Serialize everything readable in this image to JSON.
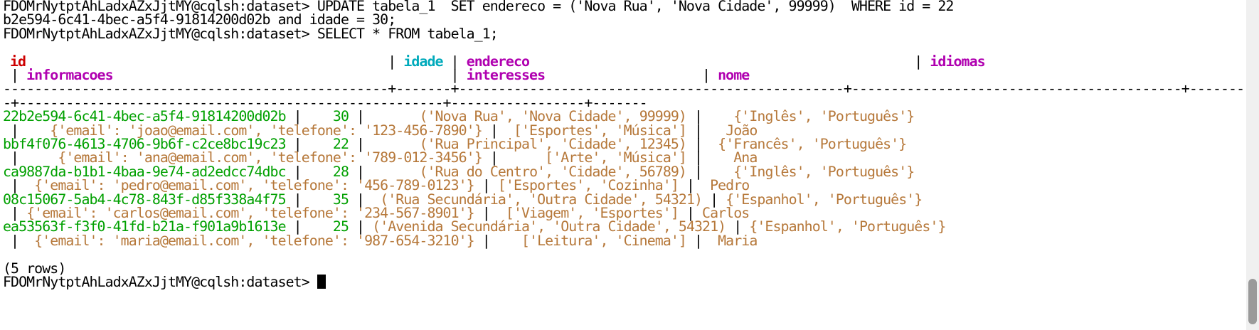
{
  "terminal": {
    "prompt": "FDOMrNytptAhLadxAZxJjtMY@cqlsh:dataset> ",
    "update_cmd_1": "UPDATE tabela_1  SET endereco = ('Nova Rua', 'Nova Cidade', 99999)  WHERE id = 22",
    "update_cmd_2": "b2e594-6c41-4bec-a5f4-91814200d02b and idade = 30;",
    "select_cmd": "SELECT * FROM tabela_1;",
    "header": {
      "id": "id",
      "idade": "idade",
      "endereco": "endereco",
      "idiomas": "idiomas",
      "informacoes": "informacoes",
      "interesses": "interesses",
      "nome": "nome"
    },
    "separator_1": "-------------------------------------------------+-------+-------------------------------------------------+------------------------------------------+--------",
    "separator_2": "-+------------------------------------------------------+-----------------+-------",
    "rows": [
      {
        "id": "22b2e594-6c41-4bec-a5f4-91814200d02b",
        "idade": "30",
        "endereco": "('Nova Rua', 'Nova Cidade', 99999)",
        "idiomas": "{'Inglês', 'Português'}",
        "informacoes": "{'email': 'joao@email.com', 'telefone': '123-456-7890'}",
        "interesses": "['Esportes', 'Música']",
        "nome": "João"
      },
      {
        "id": "bbf4f076-4613-4706-9b6f-c2ce8bc19c23",
        "idade": "22",
        "endereco": "('Rua Principal', 'Cidade', 12345)",
        "idiomas": "{'Francês', 'Português'}",
        "informacoes": "{'email': 'ana@email.com', 'telefone': '789-012-3456'}",
        "interesses": "['Arte', 'Música']",
        "nome": "Ana"
      },
      {
        "id": "ca9887da-b1b1-4baa-9e74-ad2edcc74dbc",
        "idade": "28",
        "endereco": "('Rua do Centro', 'Cidade', 56789)",
        "idiomas": "{'Inglês', 'Português'}",
        "informacoes": "{'email': 'pedro@email.com', 'telefone': '456-789-0123'}",
        "interesses": "['Esportes', 'Cozinha']",
        "nome": "Pedro"
      },
      {
        "id": "08c15067-5ab4-4c78-843f-d85f338a4f75",
        "idade": "35",
        "endereco": "('Rua Secundária', 'Outra Cidade', 54321)",
        "idiomas": "{'Espanhol', 'Português'}",
        "informacoes": "{'email': 'carlos@email.com', 'telefone': '234-567-8901'}",
        "interesses": "['Viagem', 'Esportes']",
        "nome": "Carlos"
      },
      {
        "id": "ea53563f-f3f0-41fd-b21a-f901a9b1613e",
        "idade": "25",
        "endereco": "('Avenida Secundária', 'Outra Cidade', 54321)",
        "idiomas": "{'Espanhol', 'Português'}",
        "informacoes": "{'email': 'maria@email.com', 'telefone': '987-654-3210'}",
        "interesses": "['Leitura', 'Cinema']",
        "nome": "Maria"
      }
    ],
    "row_count": "(5 rows)"
  },
  "colors": {
    "background": "#ffffff",
    "text": "#000000",
    "header_id": "#cd0000",
    "header_idade": "#00aabb",
    "header_other": "#b000b0",
    "uuid": "#00a000",
    "number": "#00a000",
    "string": "#b6783a"
  }
}
